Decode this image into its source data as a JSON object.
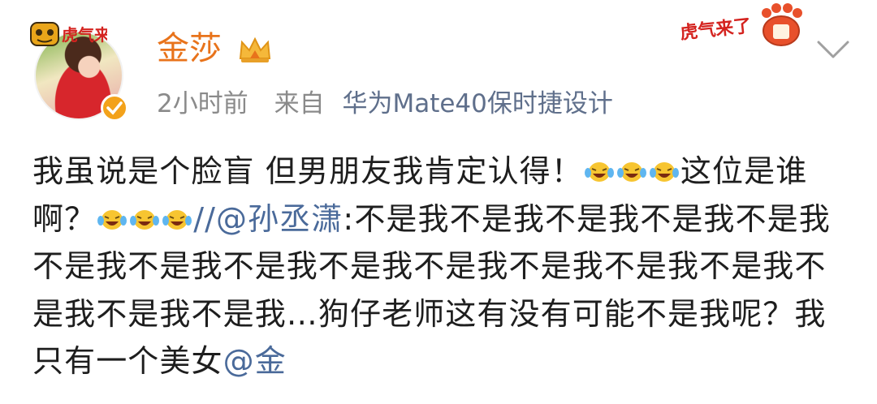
{
  "post": {
    "username": "金莎",
    "time": "2小时前",
    "source_prefix": "来自",
    "device": "华为Mate40保时捷设计",
    "avatar_badge": "虎气来了",
    "sticker": "虎气来了",
    "text_part1": "我虽说是个脸盲 但男朋友我肯定认得！",
    "text_part2": "这位是谁啊？",
    "repost_prefix": "//",
    "repost_mention": "@孙丞潇",
    "repost_text": ":不是我不是我不是我不是我不是我不是我不是我不是我不是我不是我不是我不是我不是我不是我不是我不是我…狗仔老师这有没有可能不是我呢？我只有一个美女",
    "tail_mention": "@金",
    "emoji_name": "laughing-tears-emoji",
    "colors": {
      "username": "#e8731b",
      "meta": "#8a8a8a",
      "device": "#5f6f8b",
      "mention": "#4a6a9a",
      "verified": "#f3a21b"
    }
  }
}
